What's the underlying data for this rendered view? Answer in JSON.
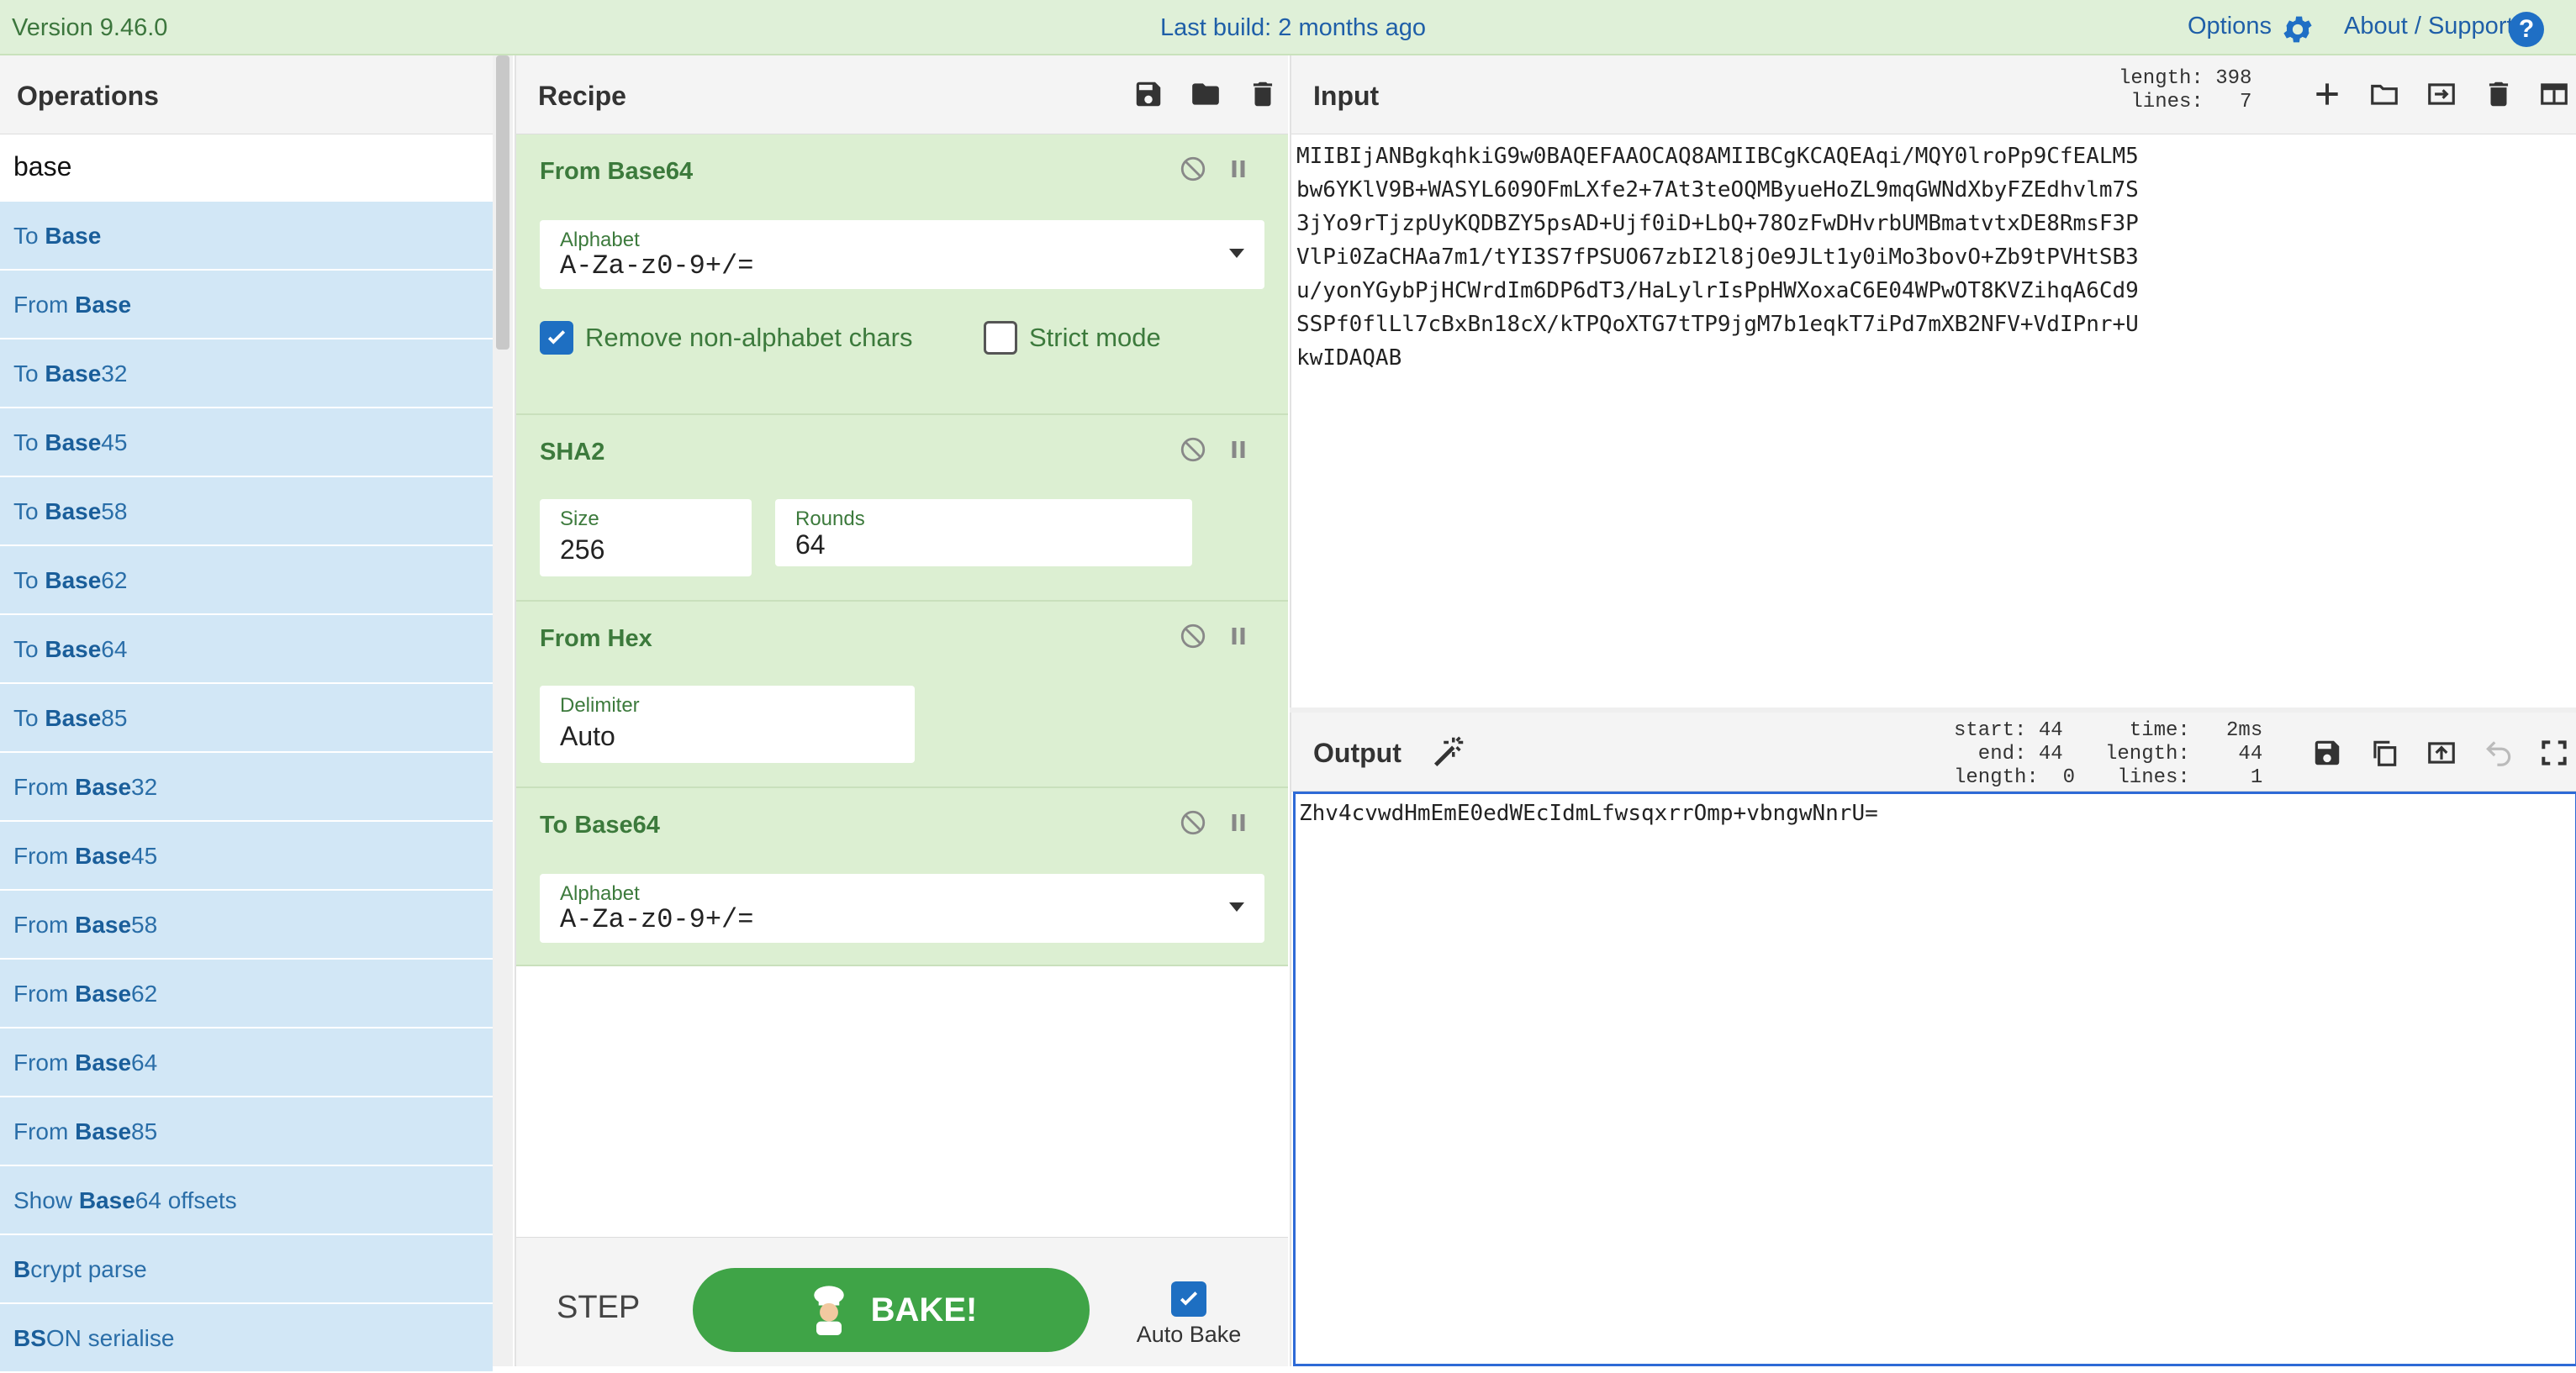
{
  "banner": {
    "version": "Version 9.46.0",
    "last_build": "Last build: 2 months ago",
    "options": "Options",
    "about": "About / Support",
    "help_glyph": "?"
  },
  "operations": {
    "title": "Operations",
    "search_value": "base",
    "items": [
      {
        "pre": "To ",
        "bold": "Base",
        "post": ""
      },
      {
        "pre": "From ",
        "bold": "Base",
        "post": ""
      },
      {
        "pre": "To ",
        "bold": "Base",
        "post": "32"
      },
      {
        "pre": "To ",
        "bold": "Base",
        "post": "45"
      },
      {
        "pre": "To ",
        "bold": "Base",
        "post": "58"
      },
      {
        "pre": "To ",
        "bold": "Base",
        "post": "62"
      },
      {
        "pre": "To ",
        "bold": "Base",
        "post": "64"
      },
      {
        "pre": "To ",
        "bold": "Base",
        "post": "85"
      },
      {
        "pre": "From ",
        "bold": "Base",
        "post": "32"
      },
      {
        "pre": "From ",
        "bold": "Base",
        "post": "45"
      },
      {
        "pre": "From ",
        "bold": "Base",
        "post": "58"
      },
      {
        "pre": "From ",
        "bold": "Base",
        "post": "62"
      },
      {
        "pre": "From ",
        "bold": "Base",
        "post": "64"
      },
      {
        "pre": "From ",
        "bold": "Base",
        "post": "85"
      },
      {
        "pre": "Show ",
        "bold": "Base",
        "post": "64 offsets"
      },
      {
        "pre": "",
        "bold": "B",
        "post": "crypt parse"
      },
      {
        "pre": "",
        "bold": "BS",
        "post": "ON serialise"
      }
    ]
  },
  "recipe": {
    "title": "Recipe",
    "ops": [
      {
        "name": "From Base64",
        "alphabet_label": "Alphabet",
        "alphabet_value": "A-Za-z0-9+/=",
        "remove_label": "Remove non-alphabet chars",
        "strict_label": "Strict mode"
      },
      {
        "name": "SHA2",
        "size_label": "Size",
        "size_value": "256",
        "rounds_label": "Rounds",
        "rounds_value": "64"
      },
      {
        "name": "From Hex",
        "delimiter_label": "Delimiter",
        "delimiter_value": "Auto"
      },
      {
        "name": "To Base64",
        "alphabet_label": "Alphabet",
        "alphabet_value": "A-Za-z0-9+/="
      }
    ],
    "step_label": "STEP",
    "bake_label": "BAKE!",
    "auto_bake_label": "Auto Bake"
  },
  "input": {
    "title": "Input",
    "stats": "length: 398\n lines:   7",
    "text": "MIIBIjANBgkqhkiG9w0BAQEFAAOCAQ8AMIIBCgKCAQEAqi/MQY0lroPp9CfEALM5\nbw6YKlV9B+WASYL609OFmLXfe2+7At3teOQMByueHoZL9mqGWNdXbyFZEdhvlm7S\n3jYo9rTjzpUyKQDBZY5psAD+Ujf0iD+LbQ+78OzFwDHvrbUMBmatvtxDE8RmsF3P\nVlPi0ZaCHAa7m1/tYI3S7fPSUO67zbI2l8jOe9JLt1y0iMo3bovO+Zb9tPVHtSB3\nu/yonYGybPjHCWrdIm6DP6dT3/HaLylrIsPpHWXoxaC6E04WPwOT8KVZihqA6Cd9\nSSPf0flLl7cBxBn18cX/kTPQoXTG7tTP9jgM7b1eqkT7iPd7mXB2NFV+VdIPnr+U\nkwIDAQAB"
  },
  "output": {
    "title": "Output",
    "stats_left": "start: 44\n  end: 44\nlength:  0",
    "stats_right": "  time:   2ms\nlength:    44\n lines:     1",
    "text": "Zhv4cvwdHmEmE0edWEcIdmLfwsqxrrOmp+vbngwNnrU="
  },
  "colors": {
    "accent": "#1e6fc2",
    "bake_green": "#3fa447",
    "recipe_bg": "#dcefd2",
    "op_list_bg": "#d2e7f6"
  }
}
